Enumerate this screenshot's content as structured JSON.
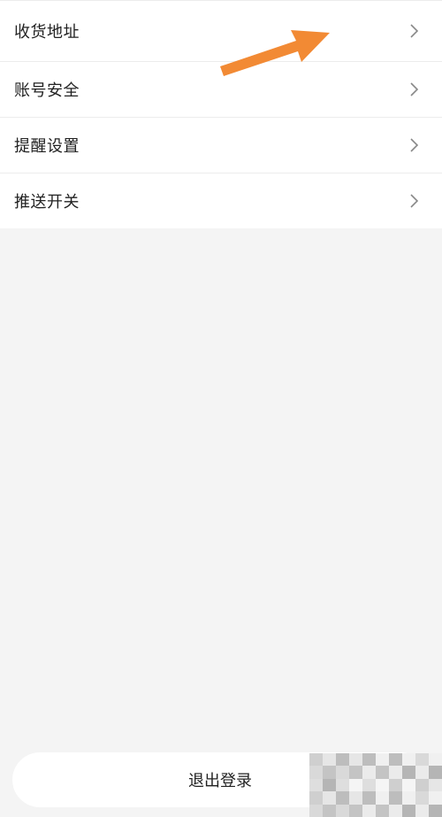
{
  "menu": {
    "items": [
      {
        "label": "收货地址"
      },
      {
        "label": "账号安全"
      },
      {
        "label": "提醒设置"
      },
      {
        "label": "推送开关"
      }
    ]
  },
  "footer": {
    "logout_label": "退出登录"
  },
  "colors": {
    "annotation_arrow": "#f28a34",
    "page_bg": "#f4f4f4",
    "card_bg": "#ffffff"
  },
  "icons": {
    "row_chevron": "chevron-right-icon",
    "annotation": "arrow-icon"
  }
}
